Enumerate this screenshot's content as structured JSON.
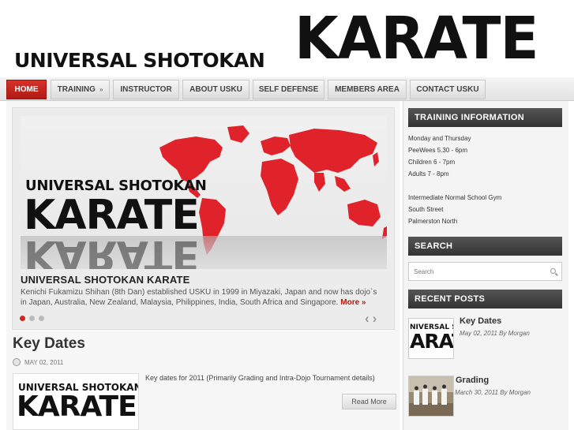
{
  "header": {
    "logo_small": "UNIVERSAL SHOTOKAN",
    "logo_big": "KARATE"
  },
  "nav": {
    "items": [
      {
        "label": "HOME",
        "active": true
      },
      {
        "label": "TRAINING",
        "has_submenu": true,
        "submenu_icon": "»"
      },
      {
        "label": "INSTRUCTOR"
      },
      {
        "label": "ABOUT USKU"
      },
      {
        "label": "SELF DEFENSE"
      },
      {
        "label": "MEMBERS AREA"
      },
      {
        "label": "CONTACT USKU"
      }
    ]
  },
  "slider": {
    "image_text_small": "UNIVERSAL SHOTOKAN",
    "image_text_big": "KARATE",
    "title": "UNIVERSAL SHOTOKAN KARATE",
    "description": "Kenichi Fukamizu Shihan (8th Dan) established USKU in 1999 in Miyazaki, Japan and now has dojo`s in Japan, Australia, New Zealand, Malaysia, Philippines, India, South Africa and Singapore.",
    "more_label": "More »",
    "prev_icon": "‹",
    "next_icon": "›",
    "accent_color": "#d0261e"
  },
  "post": {
    "title": "Key Dates",
    "date": "MAY 02, 2011",
    "thumb_text_small": "UNIVERSAL SHOTOKAN",
    "thumb_text_big": "KARATE",
    "excerpt": "Key dates for 2011 (Primarily Grading and Intra-Dojo Tournament details)",
    "read_more_label": "Read More"
  },
  "sidebar": {
    "training_title": "TRAINING INFORMATION",
    "training_lines": [
      "Monday and Thursday",
      "PeeWees 5.30 - 6pm",
      "Children 6 - 7pm",
      "Adults 7 - 8pm",
      "Intermediate Normal School Gym",
      "South Street",
      "Palmerston North"
    ],
    "search_title": "SEARCH",
    "search_placeholder": "Search",
    "recent_title": "RECENT POSTS",
    "recent_posts": [
      {
        "title": "Key Dates",
        "meta": "May 02, 2011 By Morgan",
        "thumb_text_small": "NIVERSAL SHO",
        "thumb_text_big": "ARAT"
      },
      {
        "title": "Grading",
        "meta": "March 30, 2011 By Morgan"
      }
    ]
  },
  "colors": {
    "accent": "#b01a14",
    "map_red": "#e0222a",
    "widget_header": "#3a3a3a"
  }
}
